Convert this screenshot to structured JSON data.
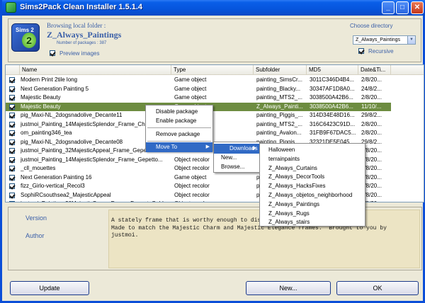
{
  "window": {
    "title": "Sims2Pack Clean Installer 1.5.1.4"
  },
  "header": {
    "logo_text": "Sims 2",
    "browse_label": "Browsing local folder :",
    "folder_name": "Z_Always_Paintings",
    "package_count": "Number of packages : 387",
    "preview_label": "Preview images",
    "choose_dir_label": "Choose directory",
    "dir_value": "Z_Always_Paintings",
    "recursive_label": "Recursive"
  },
  "list": {
    "columns": [
      "Name",
      "Type",
      "Subfolder",
      "MD5",
      "Date&Ti..."
    ],
    "rows": [
      {
        "name": "Modern Print 2tile long",
        "type": "Game object",
        "subfolder": "painting_SimsCr...",
        "md5": "3011C346D4B4...",
        "date": "2/8/20..."
      },
      {
        "name": "Next Generation Painting 5",
        "type": "Game object",
        "subfolder": "painting_Blacky...",
        "md5": "30347AF1D8A0...",
        "date": "24/8/2..."
      },
      {
        "name": "Majestic Beauty",
        "type": "Game object",
        "subfolder": "painting_MTS2_...",
        "md5": "3038500A42B6...",
        "date": "2/8/20..."
      },
      {
        "name": "Majestic Beauty",
        "type": "Game object",
        "subfolder": "Z_Always_Painti...",
        "md5": "3038500A42B6...",
        "date": "11/10/..."
      },
      {
        "name": "pig_Maxi-NL_2dogsnadolive_Decante11",
        "type": "",
        "subfolder": "painting_Piggis_...",
        "md5": "314D34E48D16...",
        "date": "29/8/2..."
      },
      {
        "name": "justmoi_Painting_14MajesticSplendor_Frame_Charl...",
        "type": "",
        "subfolder": "painting_MTS2_...",
        "md5": "316C6423C91D...",
        "date": "2/8/20..."
      },
      {
        "name": "om_painting346_tea",
        "type": "",
        "subfolder": "painting_Avalon...",
        "md5": "31FB9F67DAC5...",
        "date": "2/8/20..."
      },
      {
        "name": "pig_Maxi-NL_2dogsnadolive_Decante08",
        "type": "",
        "subfolder": "painting_Piggis_...",
        "md5": "32321DE5E045...",
        "date": "29/8/2..."
      },
      {
        "name": "justmoi_Painting_32MajesticAppeal_Frame_Gepette...",
        "type": "",
        "subfolder": "painting_MTS2_...",
        "md5": "",
        "date": "2/8/20..."
      },
      {
        "name": "justmoi_Painting_14MajesticSplendor_Frame_Gepetto...",
        "type": "Object recolor",
        "subfolder": "painting_MTS2_...",
        "md5": "",
        "date": "2/8/20..."
      },
      {
        "name": "_cll_mouettes",
        "type": "Object recolor",
        "subfolder": "painting_...",
        "md5": "",
        "date": "2/8/20..."
      },
      {
        "name": "Next Generation Painting 16",
        "type": "Game object",
        "subfolder": "painting_...",
        "md5": "",
        "date": "2/8/20..."
      },
      {
        "name": "fizz_Girlo-vertical_Recol3",
        "type": "Object recolor",
        "subfolder": "painting_...",
        "md5": "",
        "date": "2/8/20..."
      },
      {
        "name": "SophiRCsouthsea2_MajesticAppeal",
        "type": "Object recolor",
        "subfolder": "painting_...",
        "md5": "",
        "date": "2/8/20..."
      },
      {
        "name": "justmoi_Painting_30MajesticGrace_Frame_DecanteGold...",
        "type": "Object recolor",
        "subfolder": "painting_...",
        "md5": "",
        "date": "2/8/20..."
      }
    ]
  },
  "context_menu": {
    "items": [
      "Disable package",
      "Enable package",
      "Remove package",
      "Move To"
    ],
    "submenu": [
      "Downloads",
      "New...",
      "Browse..."
    ],
    "folders": [
      "Halloween",
      "terrainpaints",
      "Z_Always_Curtains",
      "Z_Always_DecorTools",
      "Z_Always_HacksFixes",
      "Z_Always_objetos_neighborhood",
      "Z_Always_Paintings",
      "Z_Always_Rugs",
      "Z_Always_stairs"
    ]
  },
  "details": {
    "version_label": "Version",
    "author_label": "Author",
    "description": "A stately frame that is worthy enough to display your masterpieces.\nMade to match the Majestic Charm and Majestic Elegance frames.  Brought to you by\njustmoi."
  },
  "buttons": {
    "update": "Update",
    "new": "New...",
    "ok": "OK"
  }
}
